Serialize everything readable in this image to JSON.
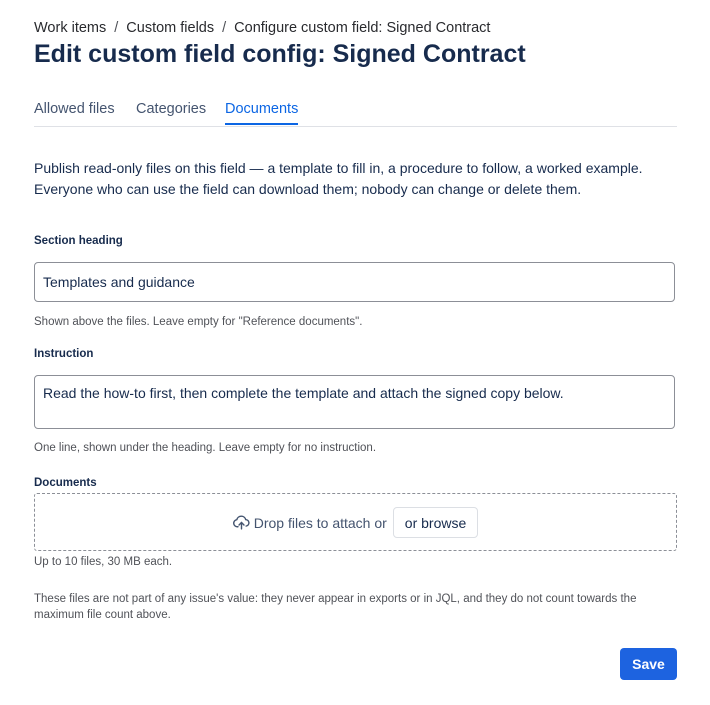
{
  "breadcrumb": {
    "items": [
      "Work items",
      "Custom fields",
      "Configure custom field: Signed Contract"
    ],
    "separator": "/"
  },
  "page": {
    "title": "Edit custom field config: Signed Contract"
  },
  "tabs": [
    {
      "label": "Allowed files",
      "active": false
    },
    {
      "label": "Categories",
      "active": false
    },
    {
      "label": "Documents",
      "active": true
    }
  ],
  "description": "Publish read-only files on this field — a template to fill in, a procedure to follow, a worked example. Everyone who can use the field can download them; nobody can change or delete them.",
  "section_heading": {
    "label": "Section heading",
    "value": "Templates and guidance",
    "help": "Shown above the files. Leave empty for \"Reference documents\"."
  },
  "instruction": {
    "label": "Instruction",
    "value": "Read the how-to first, then complete the template and attach the signed copy below.",
    "help": "One line, shown under the heading. Leave empty for no instruction."
  },
  "documents": {
    "label": "Documents",
    "drop_text": "Drop files to attach or",
    "browse_label": "or browse",
    "upload_icon": "upload-cloud-icon",
    "limit_text": "Up to 10 files, 30 MB each."
  },
  "note": "These files are not part of any issue's value: they never appear in exports or in JQL, and they do not count towards the maximum file count above.",
  "actions": {
    "save_label": "Save"
  },
  "colors": {
    "accent": "#0c66e4",
    "primary_button": "#1d63e0",
    "text": "#172b4d",
    "border": "#8c8f97"
  }
}
